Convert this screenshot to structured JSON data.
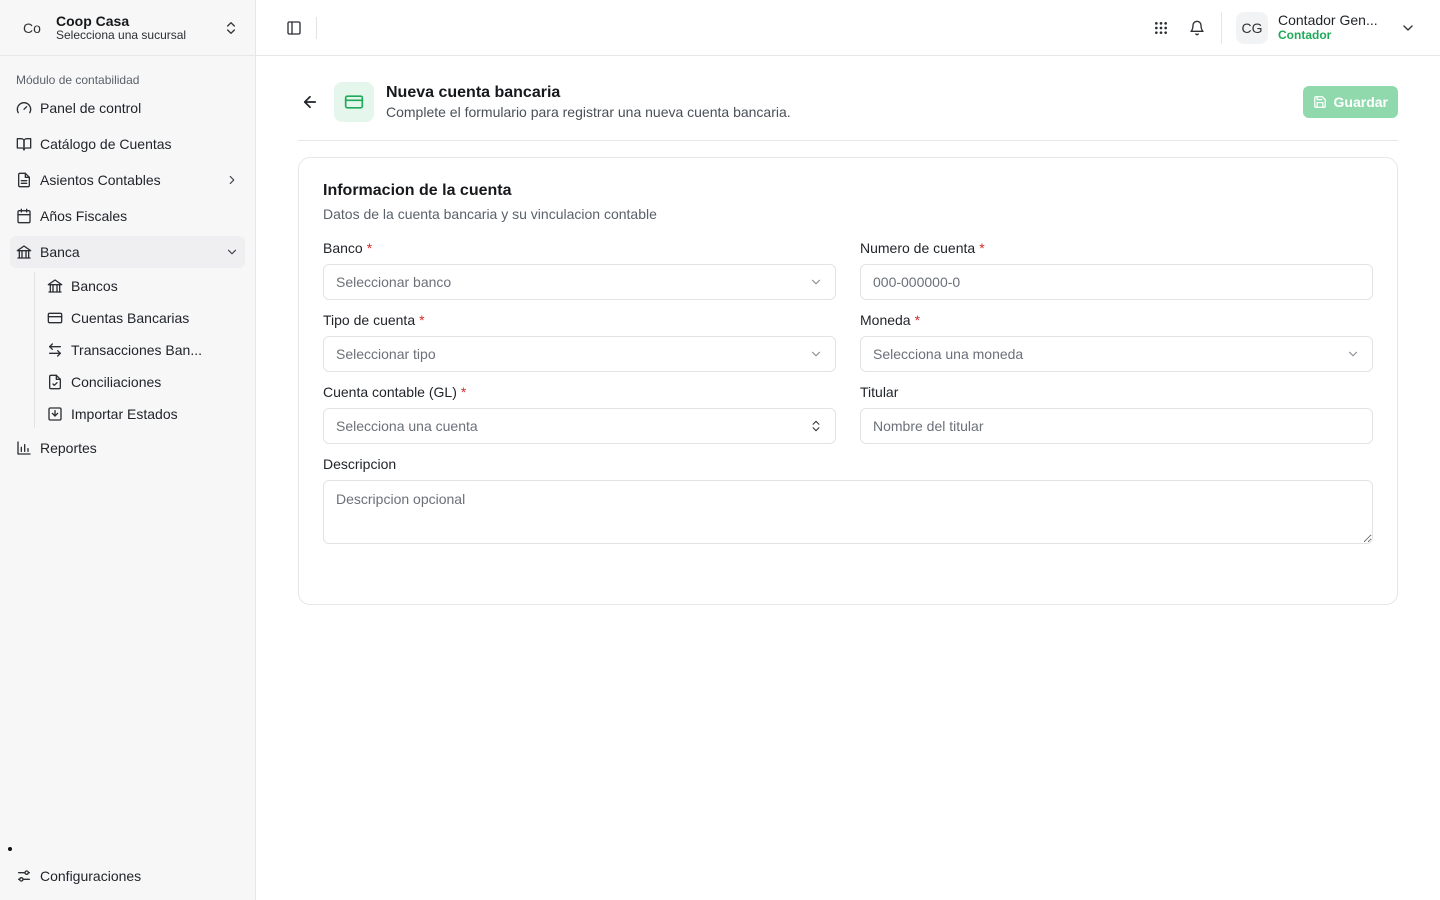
{
  "org": {
    "initials": "Co",
    "name": "Coop Casa",
    "subtitle": "Selecciona una sucursal"
  },
  "sidebar": {
    "section_label": "Módulo de contabilidad",
    "items": [
      {
        "label": "Panel de control",
        "icon": "dashboard-gauge-icon"
      },
      {
        "label": "Catálogo de Cuentas",
        "icon": "book-open-icon"
      },
      {
        "label": "Asientos Contables",
        "icon": "document-icon"
      },
      {
        "label": "Años Fiscales",
        "icon": "calendar-icon"
      },
      {
        "label": "Banca",
        "icon": "bank-icon"
      }
    ],
    "banca_children": [
      {
        "label": "Bancos",
        "icon": "bank-icon"
      },
      {
        "label": "Cuentas Bancarias",
        "icon": "credit-card-icon"
      },
      {
        "label": "Transacciones Ban...",
        "icon": "arrows-left-right-icon"
      },
      {
        "label": "Conciliaciones",
        "icon": "file-check-icon"
      },
      {
        "label": "Importar Estados",
        "icon": "import-icon"
      }
    ],
    "reports": {
      "label": "Reportes",
      "icon": "bar-chart-icon"
    },
    "settings": {
      "label": "Configuraciones",
      "icon": "settings-sliders-icon"
    }
  },
  "topbar": {
    "user": {
      "initials": "CG",
      "name": "Contador Gen...",
      "role": "Contador"
    }
  },
  "page": {
    "title": "Nueva cuenta bancaria",
    "subtitle": "Complete el formulario para registrar una nueva cuenta bancaria.",
    "save_label": "Guardar"
  },
  "form": {
    "title": "Informacion de la cuenta",
    "subtitle": "Datos de la cuenta bancaria y su vinculacion contable",
    "banco": {
      "label": "Banco",
      "placeholder": "Seleccionar banco"
    },
    "numero": {
      "label": "Numero de cuenta",
      "placeholder": "000-000000-0"
    },
    "tipo": {
      "label": "Tipo de cuenta",
      "placeholder": "Seleccionar tipo"
    },
    "moneda": {
      "label": "Moneda",
      "placeholder": "Selecciona una moneda"
    },
    "cuenta_gl": {
      "label": "Cuenta contable (GL)",
      "placeholder": "Selecciona una cuenta"
    },
    "titular": {
      "label": "Titular",
      "placeholder": "Nombre del titular"
    },
    "descripcion": {
      "label": "Descripcion",
      "placeholder": "Descripcion opcional"
    },
    "required_mark": "*"
  },
  "colors": {
    "accent": "#1faa59",
    "accent_light": "#e5f6ec",
    "save_disabled": "#8fd9ad",
    "required": "#d92c2c"
  }
}
